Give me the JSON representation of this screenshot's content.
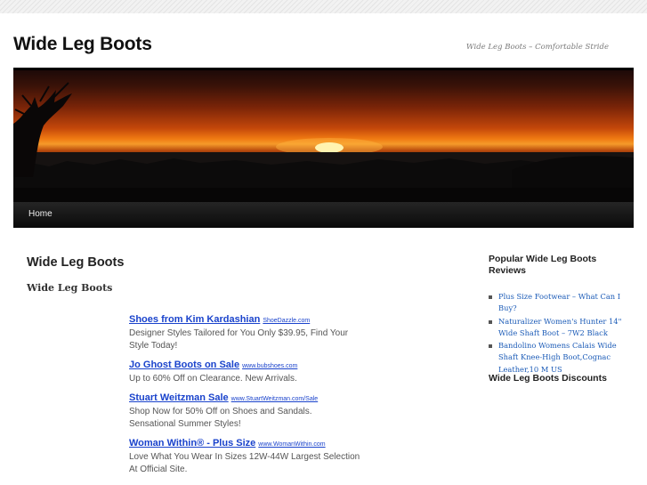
{
  "site": {
    "title": "Wide Leg Boots",
    "description": "Wide Leg Boots – Comfortable Stride"
  },
  "nav": {
    "items": [
      {
        "label": "Home"
      }
    ]
  },
  "main": {
    "post_title": "Wide Leg Boots",
    "post_subtitle": "Wide Leg Boots",
    "ads": [
      {
        "title": "Shoes from Kim Kardashian",
        "url": "ShoeDazzle.com",
        "text": "Designer Styles Tailored for You Only $39.95, Find Your Style Today!"
      },
      {
        "title": "Jo Ghost Boots on Sale",
        "url": "www.bubshoes.com",
        "text": "Up to 60% Off on Clearance. New Arrivals."
      },
      {
        "title": "Stuart Weitzman Sale",
        "url": "www.StuartWeitzman.com/Sale",
        "text": "Shop Now for 50% Off on Shoes and Sandals. Sensational Summer Styles!"
      },
      {
        "title": "Woman Within® - Plus Size",
        "url": "www.WomanWithin.com",
        "text": "Love What You Wear In Sizes 12W-44W Largest Selection At Official Site."
      }
    ]
  },
  "sidebar": {
    "popular_title": "Popular Wide Leg Boots Reviews",
    "popular_items": [
      {
        "label": "Plus Size Footwear – What Can I Buy?"
      },
      {
        "label": "Naturalizer Women's Hunter 14\" Wide Shaft Boot – 7W2 Black"
      },
      {
        "label": "Bandolino Womens Calais Wide Shaft Knee-High Boot,Cognac Leather,10 M US"
      }
    ],
    "discounts_title": "Wide Leg Boots Discounts"
  },
  "colors": {
    "link": "#1b5bb7",
    "ad_link": "#1a43cc",
    "nav_bg": "#111111",
    "header_rule": "#000000"
  }
}
